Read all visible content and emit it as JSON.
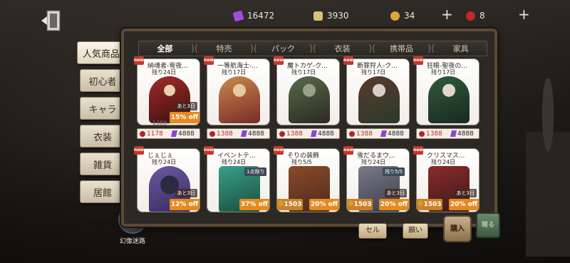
{
  "currencies": [
    {
      "icon": "purple-crystal-icon",
      "color": "#9b4fe0",
      "value": "16472"
    },
    {
      "icon": "puzzle-piece-icon",
      "color": "#d8c07a",
      "value": "3930"
    },
    {
      "icon": "gold-coin-icon",
      "color": "#e0a43a",
      "value": "34"
    },
    {
      "icon": "red-orb-icon",
      "color": "#c0282b",
      "value": "8"
    }
  ],
  "nav": [
    {
      "label": "人気商品",
      "active": true
    },
    {
      "label": "初心者"
    },
    {
      "label": "キャラ"
    },
    {
      "label": "衣装"
    },
    {
      "label": "雑貨"
    },
    {
      "label": "居館"
    }
  ],
  "illusion": {
    "label": "幻像迷路"
  },
  "tabs": [
    "全部",
    "特売",
    "パック",
    "衣装",
    "携帯品",
    "家具"
  ],
  "cards": [
    {
      "title": "納魂者-雪夜...",
      "remain": "残り24日",
      "time": "あと3日",
      "off": "15% off",
      "orig": "1388",
      "price_a": "1178",
      "price_b": "4888",
      "fig": "#a32a2a"
    },
    {
      "title": "一等航海士-...",
      "remain": "残り17日",
      "price_a": "1388",
      "price_b": "4888",
      "fig": "#c98a4a"
    },
    {
      "title": "魔トカゲ-ク...",
      "remain": "残り17日",
      "price_a": "1388",
      "price_b": "4888",
      "fig": "#5a6a4a"
    },
    {
      "title": "断罪狩人-ク...",
      "remain": "残り17日",
      "price_a": "1388",
      "price_b": "4888",
      "fig": "#5a3a2e"
    },
    {
      "title": "狂眼-聖夜の...",
      "remain": "残り17日",
      "price_a": "1388",
      "price_b": "4888",
      "fig": "#2f5a3a"
    },
    {
      "title": "じぇじぇ",
      "remain": "残り24日",
      "time": "あと3日",
      "off": "12% off",
      "fig": "#6a5aa0"
    },
    {
      "title": "イベントテ...",
      "remain": "残り24日",
      "limit": "1点限り",
      "off": "37% off",
      "fig": "#3aa08a"
    },
    {
      "title": "そりの装飾",
      "remain": "残り5/5",
      "off": "20% off",
      "price_a": "1503",
      "fig": "#8a4a2a"
    },
    {
      "title": "雪だるまウ...",
      "remain": "残り24日",
      "limit": "残り5/5",
      "time": "あと3日",
      "off": "20% off",
      "price_a": "1503",
      "fig": "#7a7a8a"
    },
    {
      "title": "クリスマス...",
      "remain": "残り24日",
      "time": "あと3日",
      "off": "20% off",
      "price_a": "1503",
      "fig": "#8a2a2a"
    }
  ],
  "bottom": {
    "sell": "セル",
    "wish": "願い",
    "cart": "購入",
    "gift": "贈る"
  }
}
